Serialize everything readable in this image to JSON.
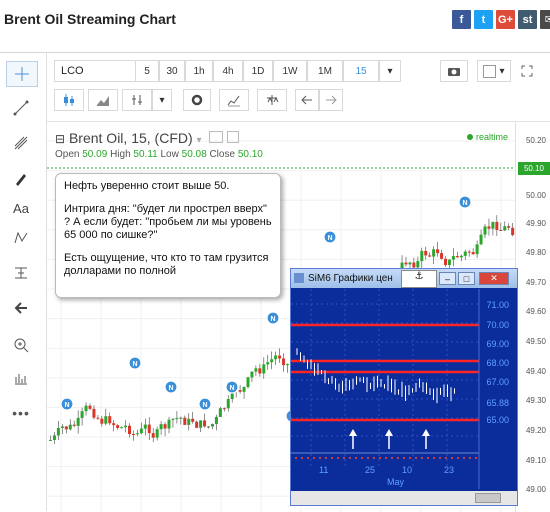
{
  "page": {
    "title": "Brent Oil Streaming Chart"
  },
  "share": [
    {
      "icon": "facebook-icon",
      "glyph": "f",
      "color": "#3b5998"
    },
    {
      "icon": "twitter-icon",
      "glyph": "t",
      "color": "#1da1f2"
    },
    {
      "icon": "google-plus-icon",
      "glyph": "G+",
      "color": "#dd4b39"
    },
    {
      "icon": "stocktwits-icon",
      "glyph": "st",
      "color": "#405a70"
    },
    {
      "icon": "email-icon",
      "glyph": "✉",
      "color": "#4a4a4a"
    }
  ],
  "toolbar": {
    "symbol": "LCO",
    "intervals": [
      "5",
      "30",
      "1h",
      "4h",
      "1D",
      "1W",
      "1M",
      "15"
    ],
    "active_interval": "15"
  },
  "legend": {
    "title": "Brent Oil, 15, (CFD)",
    "open_label": "Open",
    "open": "50.09",
    "high_label": "High",
    "high": "50.11",
    "low_label": "Low",
    "low": "50.08",
    "close_label": "Close",
    "close": "50.10",
    "status": "realtime"
  },
  "price_axis": {
    "ticks": [
      "50.20",
      "50.00",
      "49.90",
      "49.80",
      "49.70",
      "49.60",
      "49.50",
      "49.40",
      "49.30",
      "49.20",
      "49.10",
      "49.00"
    ],
    "last_price": "50.10"
  },
  "news_marker": {
    "glyph": "N",
    "color": "#3b8fd9"
  },
  "bubble": {
    "line1": "Нефть уверенно стоит выше 50.",
    "line2": "Интрига дня: \"будет ли прострел вверх\" ? А если будет: \"пробьем ли мы уровень 65 000 по сишке?\"",
    "line3": "Есть ощущение, что кто то там грузится долларами по полной"
  },
  "inner_window": {
    "title": "SiM6 Графики цен",
    "y_ticks": [
      "71.00",
      "70.00",
      "69.00",
      "68.00",
      "67.00",
      "65.88",
      "65.00"
    ],
    "x_ticks": [
      "11",
      "25",
      "10",
      "23"
    ],
    "x_month": "May"
  },
  "colors": {
    "up": "#2ba52b",
    "down": "#d9362b",
    "accent": "#3b8fd9"
  }
}
